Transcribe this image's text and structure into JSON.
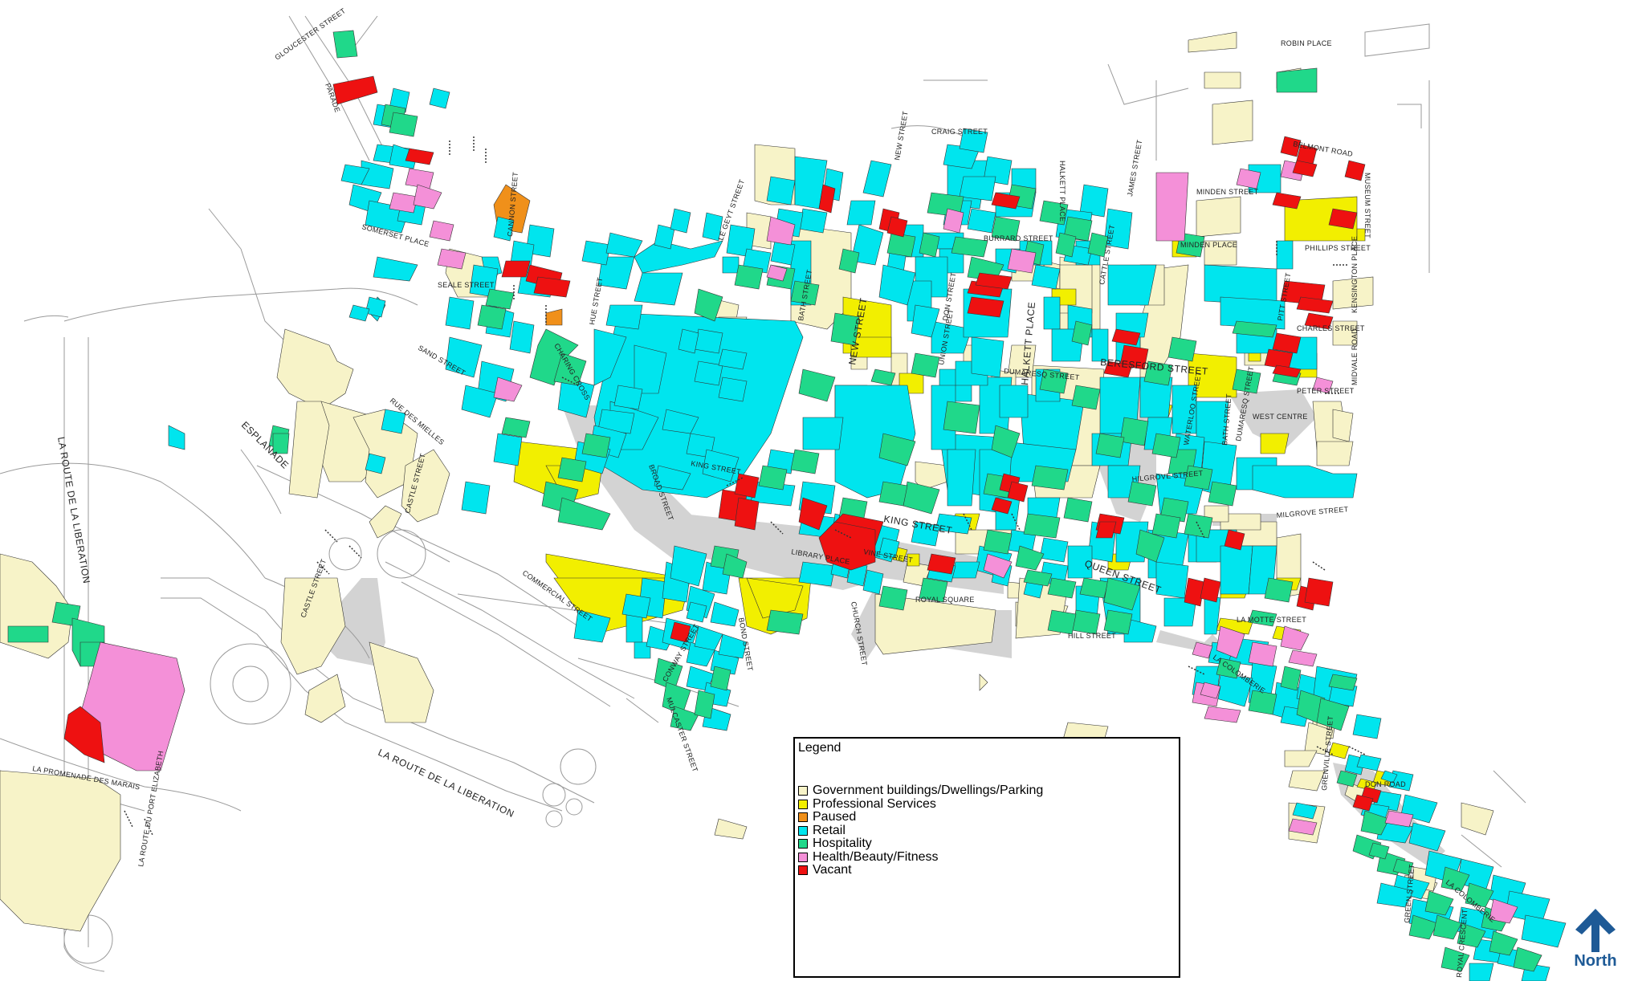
{
  "legend": {
    "title": "Legend",
    "items": [
      {
        "label": "Government buildings/Dwellings/Parking",
        "color": "#f7f3c8"
      },
      {
        "label": "Professional Services",
        "color": "#f2ef00"
      },
      {
        "label": "Paused",
        "color": "#f0901a"
      },
      {
        "label": "Retail",
        "color": "#00e5ee"
      },
      {
        "label": "Hospitality",
        "color": "#20d88a"
      },
      {
        "label": "Health/Beauty/Fitness",
        "color": "#f490d8"
      },
      {
        "label": "Vacant",
        "color": "#ee1111"
      }
    ]
  },
  "north": {
    "label": "North",
    "color": "#1e5a96"
  },
  "streets": {
    "gloucester": "GLOUCESTER STREET",
    "parade": "PARADE",
    "somerset": "SOMERSET PLACE",
    "seale": "SEALE STREET",
    "sand": "SAND STREET",
    "esplanade": "ESPLANADE",
    "rue_des_mielles": "RUE DES MIELLES",
    "castle": "CASTLE STREET",
    "castle2": "CASTLE STREET",
    "commercial": "COMMERCIAL STREET",
    "route_liberation_left": "LA ROUTE DE LA LIBERATION",
    "route_liberation": "LA ROUTE DE LA LIBERATION",
    "promenade": "LA PROMENADE DES MARAIS",
    "route_port": "LA ROUTE DU PORT ELIZABETH",
    "king": "KING STREET",
    "king2": "KING STREET",
    "library": "LIBRARY PLACE",
    "vine": "VINE STREET",
    "royal_square": "ROYAL SQUARE",
    "queen": "QUEEN STREET",
    "hill": "HILL STREET",
    "halkett": "HALKETT PLACE",
    "halkett2": "HALKETT PLACE",
    "beresford": "BERESFORD STREET",
    "peter": "PETER STREET",
    "minden": "MINDEN STREET",
    "minden_place": "MINDEN PLACE",
    "phillips": "PHILLIPS STREET",
    "belmont": "BELMONT ROAD",
    "robin": "ROBIN PLACE",
    "charles": "CHARLES STREET",
    "milgrove": "MILGROVE STREET",
    "la_motte": "LA MOTTE STREET",
    "don_road": "DON ROAD",
    "green": "GREEN STREET",
    "colomberie": "LA COLOMBERIE",
    "craig": "CRAIG STREET",
    "new": "NEW STREET",
    "new2": "NEW STREET",
    "le_geyt": "LE GEYT STREET",
    "burrard": "BURRARD STREET",
    "dumaresq": "DUMARESQ STREET",
    "bath": "BATH STREET",
    "broad": "BROAD STREET",
    "mulcaster": "MULCASTER STREET",
    "bond": "BOND STREET",
    "church": "CHURCH STREET",
    "conway": "CONWAY STREET",
    "waterloo": "WATERLOO STREET",
    "union": "UNION STREET",
    "don": "DON STREET",
    "james": "JAMES STREET",
    "cattle": "CATTLE STREET",
    "grenville": "GRENVILLE STREET",
    "bath2": "BATH STREET",
    "colomberie2": "LA COLOMBERIE",
    "royal_crescent": "ROYAL CRESCENT",
    "westmount": "WEST CENTRE",
    "hue": "HUE STREET",
    "pitt": "PITT STREET",
    "dumaresq2": "DUMARESQ STREET",
    "museum": "MUSEUM STREET",
    "midvale": "MIDVALE ROAD",
    "kensington": "KENSINGTON PLACE",
    "cannon": "CANNON STREET",
    "charing": "CHARING CROSS",
    "hilgrove": "HILGROVE STREET"
  }
}
